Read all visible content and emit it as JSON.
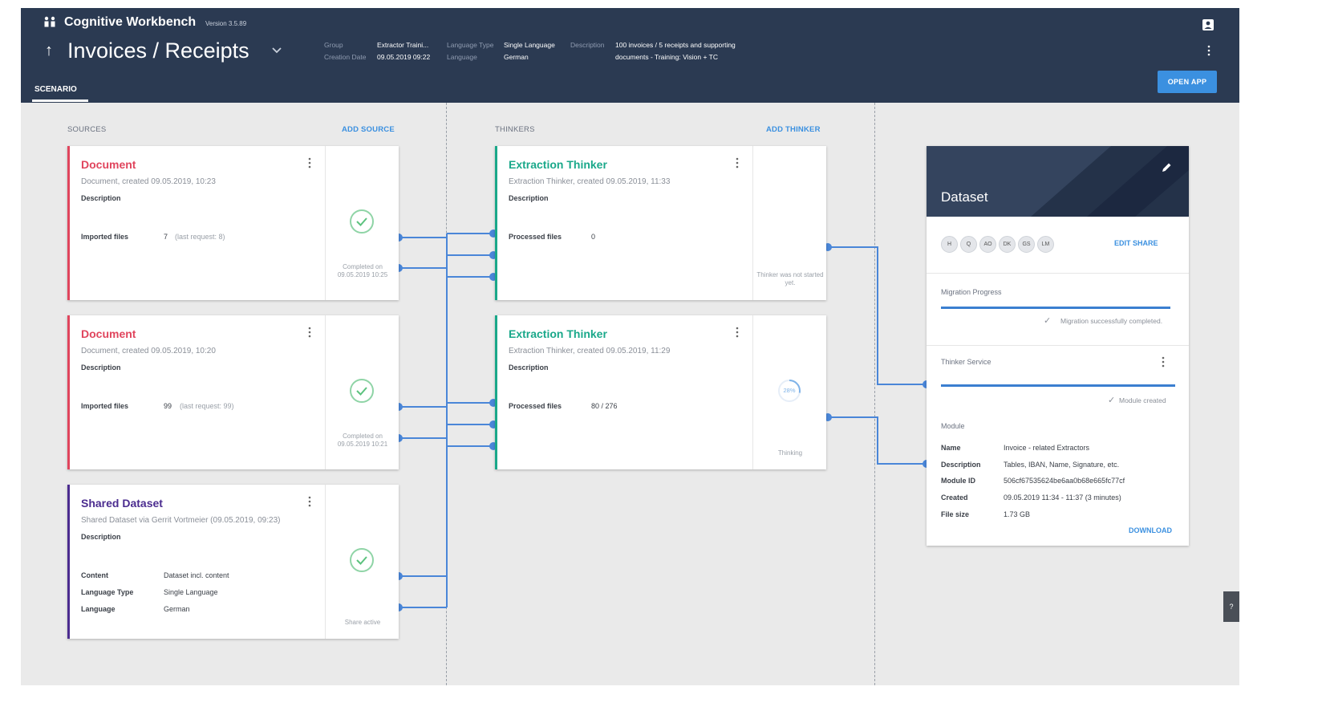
{
  "header": {
    "app_title": "Cognitive Workbench",
    "version": "Version 3.5.89",
    "scenario_title": "Invoices / Receipts",
    "meta": {
      "group_label": "Group",
      "group_value": "Extractor Traini...",
      "creation_date_label": "Creation Date",
      "creation_date_value": "09.05.2019 09:22",
      "language_type_label": "Language Type",
      "language_type_value": "Single Language",
      "language_label": "Language",
      "language_value": "German",
      "description_label": "Description",
      "description_line1": "100 invoices / 5 receipts and supporting",
      "description_line2": "documents - Training: Vision + TC"
    },
    "tab_label": "SCENARIO",
    "open_app_label": "OPEN APP",
    "icons": {
      "account": "account-icon",
      "more": "more-vert-icon",
      "back": "arrow-up-icon",
      "dropdown": "chevron-down-icon"
    }
  },
  "sources": {
    "label": "SOURCES",
    "add_label": "ADD SOURCE",
    "cards": [
      {
        "title": "Document",
        "subtitle": "Document, created 09.05.2019, 10:23",
        "description_label": "Description",
        "rows": [
          {
            "key": "Imported files",
            "value": "7",
            "note": "(last request: 8)"
          }
        ],
        "status": "Completed on 09.05.2019 10:25",
        "accent": "#e0455d"
      },
      {
        "title": "Document",
        "subtitle": "Document, created 09.05.2019, 10:20",
        "description_label": "Description",
        "rows": [
          {
            "key": "Imported files",
            "value": "99",
            "note": "(last request: 99)"
          }
        ],
        "status": "Completed on 09.05.2019 10:21",
        "accent": "#e0455d"
      },
      {
        "title": "Shared Dataset",
        "subtitle": "Shared Dataset via Gerrit Vortmeier (09.05.2019, 09:23)",
        "description_label": "Description",
        "rows": [
          {
            "key": "Content",
            "value": "Dataset incl. content"
          },
          {
            "key": "Language Type",
            "value": "Single Language"
          },
          {
            "key": "Language",
            "value": "German"
          }
        ],
        "status": "Share active",
        "accent": "#4b2c8f"
      }
    ]
  },
  "thinkers": {
    "label": "THINKERS",
    "add_label": "ADD THINKER",
    "cards": [
      {
        "title": "Extraction Thinker",
        "subtitle": "Extraction Thinker, created 09.05.2019, 11:33",
        "description_label": "Description",
        "rows": [
          {
            "key": "Processed files",
            "value": "0"
          }
        ],
        "status": "Thinker was not started yet.",
        "accent": "#1aa88a"
      },
      {
        "title": "Extraction Thinker",
        "subtitle": "Extraction Thinker, created 09.05.2019, 11:29",
        "description_label": "Description",
        "rows": [
          {
            "key": "Processed files",
            "value": "80 / 276"
          }
        ],
        "status": "Thinking",
        "progress_label": "28%",
        "progress": 0.28,
        "accent": "#1aa88a"
      }
    ]
  },
  "dataset": {
    "title": "Dataset",
    "avatars": [
      "H",
      "Q",
      "AO",
      "DK",
      "GS",
      "LM"
    ],
    "edit_share_label": "EDIT SHARE",
    "migration": {
      "label": "Migration Progress",
      "progress": 1.0,
      "note": "Migration successfully completed."
    },
    "thinker_service": {
      "label": "Thinker Service",
      "progress": 1.0,
      "note": "Module created"
    },
    "module": {
      "label": "Module",
      "rows": [
        {
          "key": "Name",
          "value": "Invoice - related Extractors"
        },
        {
          "key": "Description",
          "value": "Tables, IBAN, Name, Signature, etc."
        },
        {
          "key": "Module ID",
          "value": "506cf67535624be6aa0b68e665fc77cf"
        },
        {
          "key": "Created",
          "value": "09.05.2019 11:34 - 11:37 (3 minutes)"
        },
        {
          "key": "File size",
          "value": "1.73 GB"
        }
      ]
    },
    "download_label": "DOWNLOAD"
  },
  "help_label": "?",
  "colors": {
    "header": "#2b3a52",
    "accent_blue": "#3b90e0",
    "connector": "#4a86d8",
    "background": "#eaeaea"
  }
}
